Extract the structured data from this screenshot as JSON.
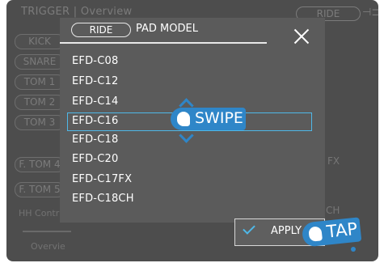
{
  "background": {
    "title": "TRIGGER | Overview",
    "ride_pill": "RIDE",
    "pads": [
      "KICK",
      "SNARE",
      "TOM 1",
      "TOM 2",
      "TOM 3",
      "F. TOM 4",
      "F. TOM 5"
    ],
    "hh_control": "HH Contr",
    "overview_tab": "Overvie",
    "fx_fragment": "FX",
    "ch_fragment": "CH"
  },
  "modal": {
    "ride_pill": "RIDE",
    "title": "PAD MODEL",
    "items": [
      "EFD-C08",
      "EFD-C12",
      "EFD-C14",
      "EFD-C16",
      "EFD-C18",
      "EFD-C20",
      "EFD-C17FX",
      "EFD-C18CH"
    ],
    "selected_index": 3,
    "apply_label": "APPLY"
  },
  "hints": {
    "swipe": "SWIPE",
    "tap": "TAP"
  },
  "colors": {
    "accent": "#2f86c8",
    "selection": "#4fb8e8",
    "modal_bg": "#5b5b5b",
    "screen_bg": "#4d4d4d"
  }
}
